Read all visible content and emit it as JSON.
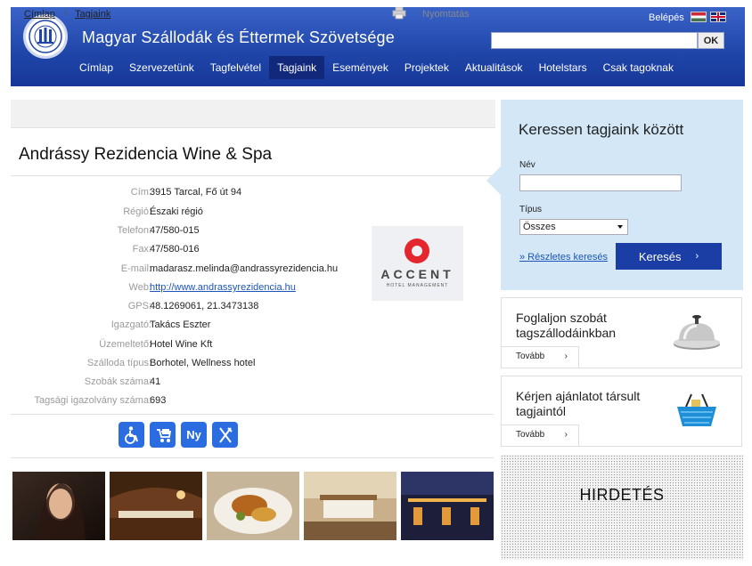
{
  "header": {
    "site_title": "Magyar Szállodák és Éttermek Szövetsége",
    "login": "Belépés",
    "search_placeholder": "",
    "ok": "OK",
    "nav": [
      "Címlap",
      "Szervezetünk",
      "Tagfelvétel",
      "Tagjaink",
      "Események",
      "Projektek",
      "Aktualitások",
      "Hotelstars",
      "Csak tagoknak"
    ],
    "active_nav": "Tagjaink"
  },
  "breadcrumb": {
    "home": "Címlap",
    "sep": "›",
    "current": "Tagjaink",
    "print": "Nyomtatás"
  },
  "listing": {
    "title": "Andrássy Rezidencia Wine & Spa",
    "details": [
      {
        "label": "Cím:",
        "value": "3915 Tarcal, Fő út 94"
      },
      {
        "label": "Régió:",
        "value": "Északi régió"
      },
      {
        "label": "Telefon:",
        "value": "47/580-015"
      },
      {
        "label": "Fax:",
        "value": "47/580-016"
      },
      {
        "label": "E-mail:",
        "value": "madarasz.melinda@andrassyrezidencia.hu"
      },
      {
        "label": "Web:",
        "value": "http://www.andrassyrezidencia.hu"
      },
      {
        "label": "GPS:",
        "value": "48.1269061, 21.3473138"
      },
      {
        "label": "Igazgató:",
        "value": "Takács Eszter"
      },
      {
        "label": "Üzemeltető:",
        "value": "Hotel Wine Kft"
      },
      {
        "label": "Szálloda típus:",
        "value": "Borhotel, Wellness hotel"
      },
      {
        "label": "Szobák száma:",
        "value": "41"
      },
      {
        "label": "Tagsági igazolvány száma:",
        "value": "693"
      }
    ],
    "partner_logo": {
      "name": "ACCENT",
      "sub": "HOTEL MANAGEMENT"
    },
    "amenities": [
      "wheelchair-icon",
      "stroller-icon",
      "Ny",
      "restaurant-icon"
    ],
    "photos": [
      "photo-woman",
      "photo-restaurant",
      "photo-food",
      "photo-room",
      "photo-terrace"
    ]
  },
  "search_panel": {
    "title": "Keressen tagjaink között",
    "name_label": "Név",
    "name_value": "",
    "type_label": "Típus",
    "type_value": "Összes",
    "advanced": "» Részletes keresés",
    "submit": "Keresés"
  },
  "promos": [
    {
      "text": "Foglaljon szobát tagszállodáinkban",
      "link": "Tovább",
      "icon": "bell-icon"
    },
    {
      "text": "Kérjen ajánlatot társult tagjaintól",
      "link": "Tovább",
      "icon": "basket-icon"
    }
  ],
  "ad": {
    "text": "HIRDETÉS"
  },
  "colors": {
    "header_blue": "#1f45a8",
    "nav_active": "#12287a",
    "search_panel_bg": "#d3e7f6",
    "button_blue": "#1a3ea5",
    "link": "#1d56b8",
    "amenity_blue": "#2b6de0"
  }
}
